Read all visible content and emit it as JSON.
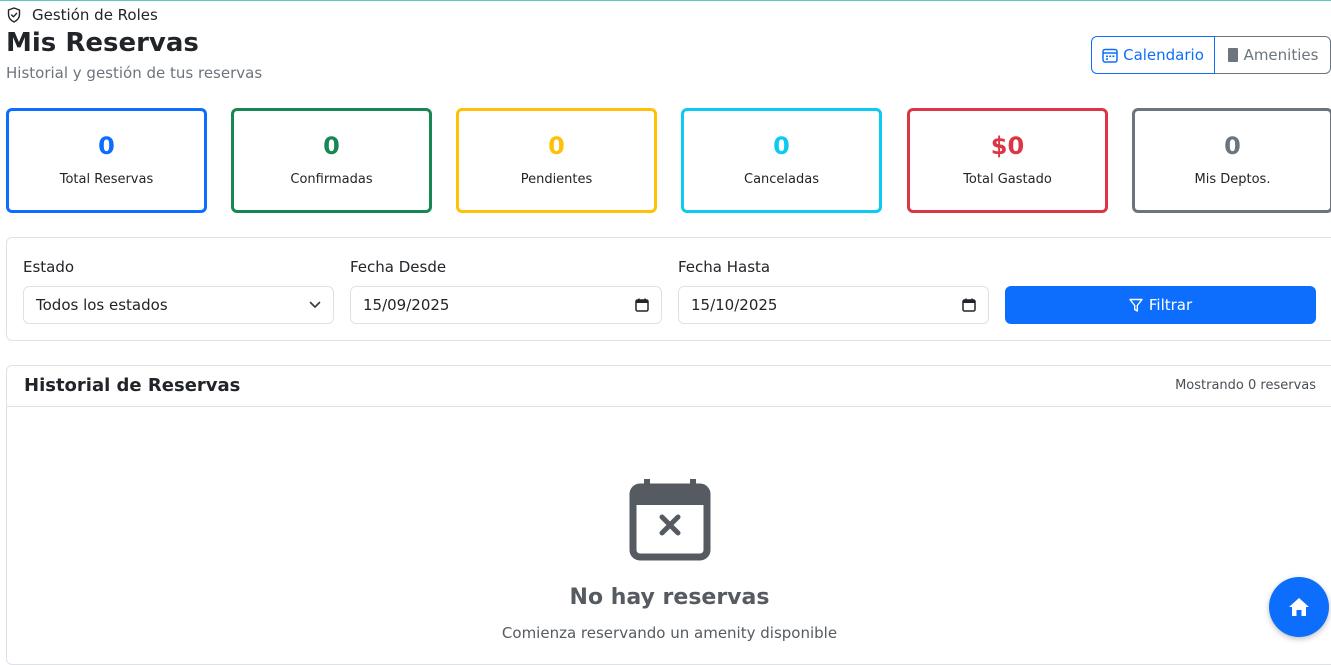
{
  "breadcrumb": {
    "label": "Gestión de Roles"
  },
  "header": {
    "title": "Mis Reservas",
    "subtitle": "Historial y gestión de tus reservas"
  },
  "view_toggle": {
    "calendar_label": "Calendario",
    "amenities_label": "Amenities"
  },
  "stats": [
    {
      "value": "0",
      "label": "Total Reservas",
      "color": "#0d6efd"
    },
    {
      "value": "0",
      "label": "Confirmadas",
      "color": "#198754"
    },
    {
      "value": "0",
      "label": "Pendientes",
      "color": "#ffc107"
    },
    {
      "value": "0",
      "label": "Canceladas",
      "color": "#0dcaf0"
    },
    {
      "value": "$0",
      "label": "Total Gastado",
      "color": "#dc3545"
    },
    {
      "value": "0",
      "label": "Mis Deptos.",
      "color": "#6c757d"
    }
  ],
  "filters": {
    "estado_label": "Estado",
    "estado_value": "Todos los estados",
    "desde_label": "Fecha Desde",
    "desde_value": "15/09/2025",
    "hasta_label": "Fecha Hasta",
    "hasta_value": "15/10/2025",
    "filter_button": "Filtrar"
  },
  "history": {
    "title": "Historial de Reservas",
    "count_text": "Mostrando 0 reservas",
    "empty_title": "No hay reservas",
    "empty_subtitle": "Comienza reservando un amenity disponible"
  },
  "icons": {
    "breadcrumb": "shield-check-icon",
    "calendar_toggle": "calendar-week-icon",
    "amenities_toggle": "building-icon",
    "select_caret": "chevron-down-icon",
    "date_picker": "calendar-icon",
    "filter": "funnel-icon",
    "empty_state": "calendar-x-icon",
    "fab": "house-icon"
  }
}
